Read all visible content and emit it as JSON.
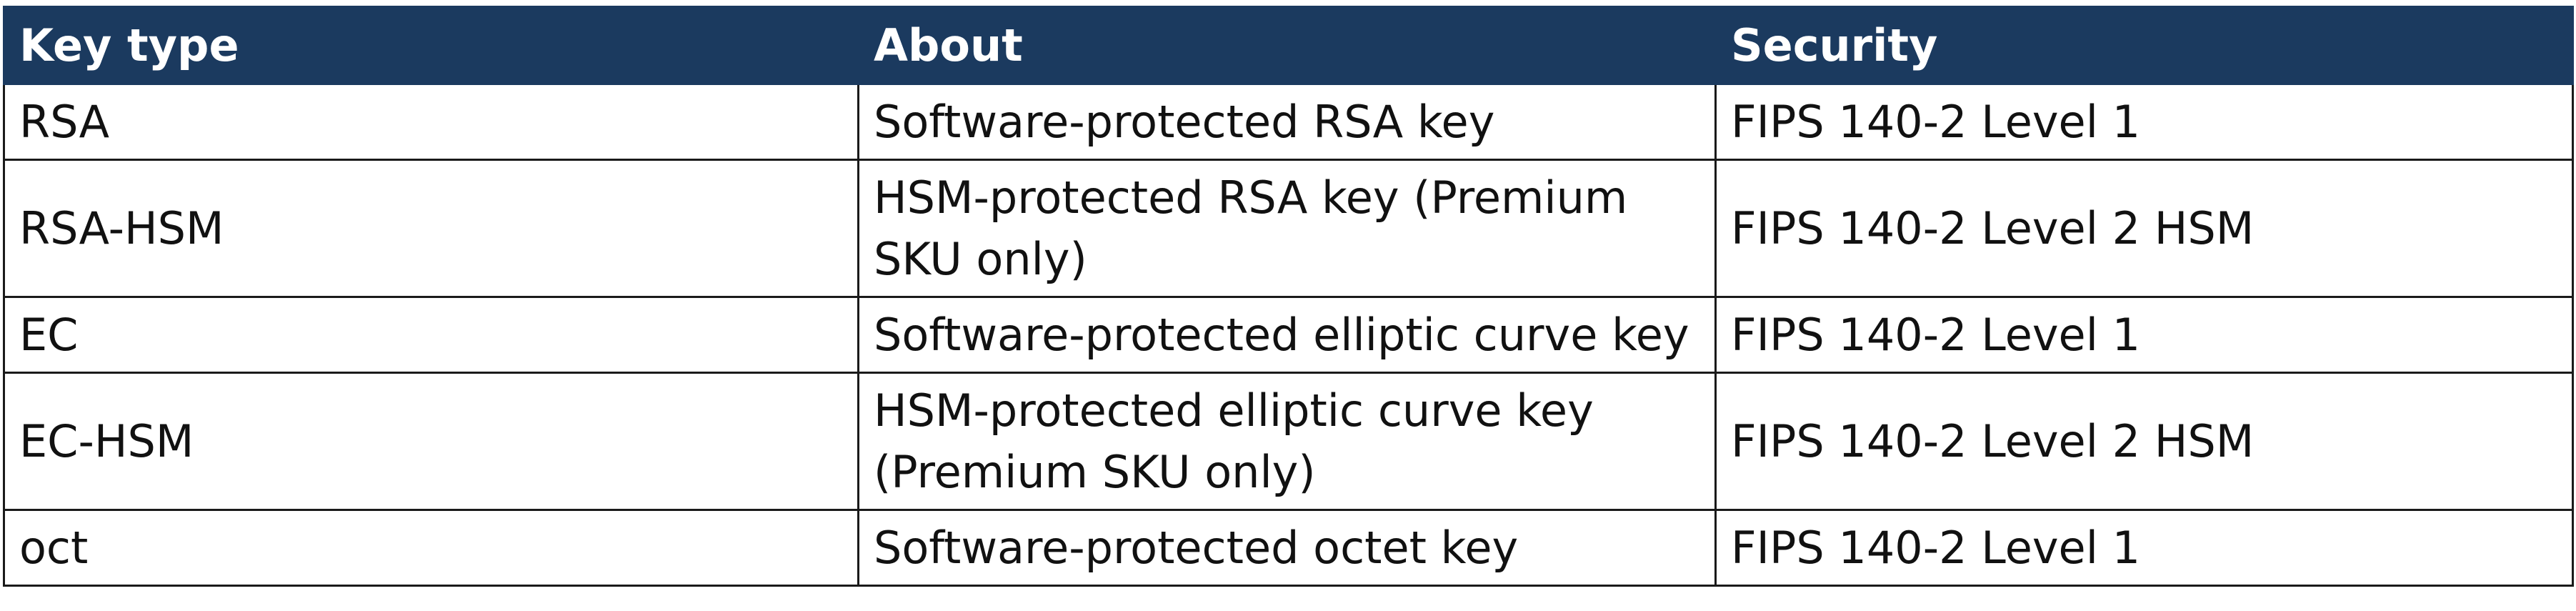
{
  "table": {
    "headers": [
      "Key type",
      "About",
      "Security"
    ],
    "rows": [
      [
        "RSA",
        "Software-protected RSA key",
        "FIPS 140-2 Level 1"
      ],
      [
        "RSA-HSM",
        "HSM-protected RSA key (Premium SKU only)",
        "FIPS 140-2 Level 2 HSM"
      ],
      [
        "EC",
        "Software-protected elliptic curve key",
        "FIPS 140-2 Level 1"
      ],
      [
        "EC-HSM",
        "HSM-protected elliptic curve key (Premium SKU only)",
        "FIPS 140-2 Level 2 HSM"
      ],
      [
        "oct",
        "Software-protected octet key",
        "FIPS 140-2 Level 1"
      ]
    ]
  },
  "colors": {
    "header_background": "#1b3a5f",
    "header_text": "#ffffff",
    "border": "#1a1a1a"
  }
}
